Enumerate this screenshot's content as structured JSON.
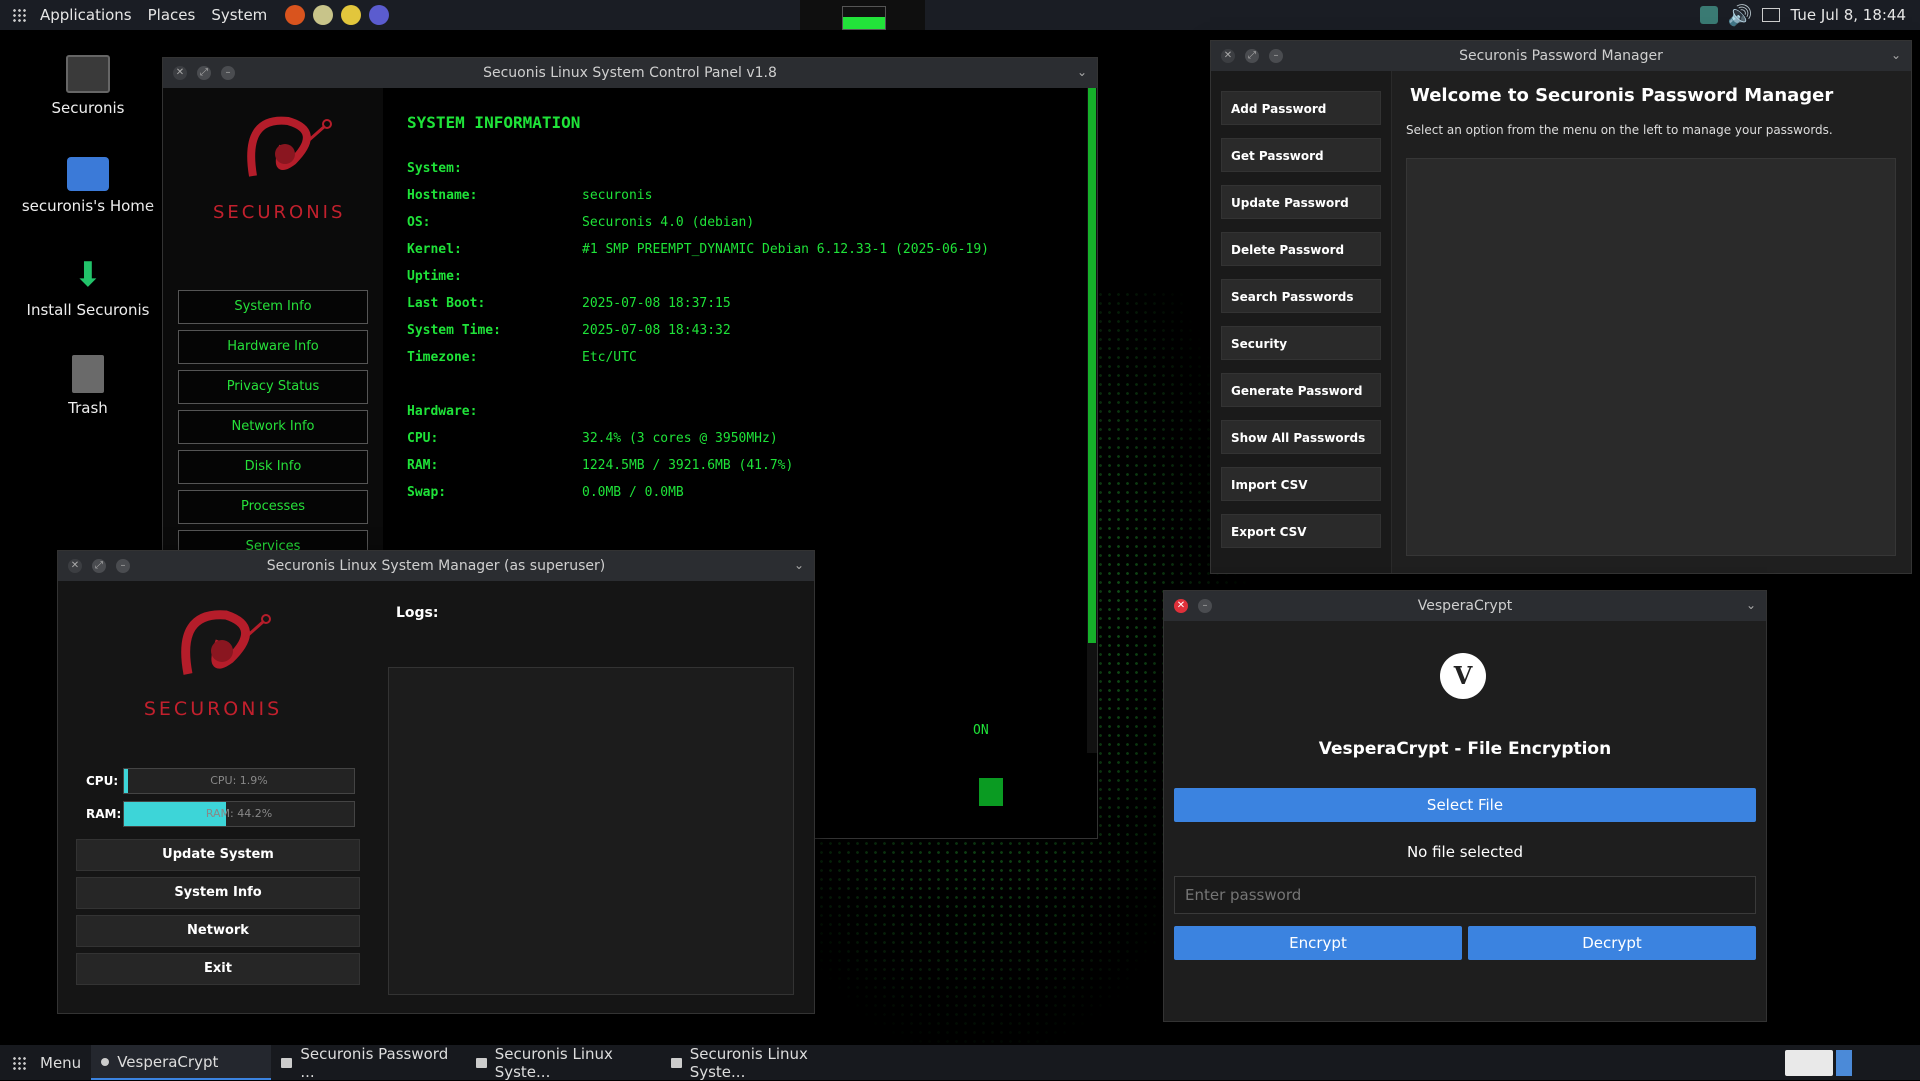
{
  "top_panel": {
    "menus": [
      "Applications",
      "Places",
      "System"
    ],
    "clock": "Tue Jul  8, 18:44"
  },
  "desktop_icons": [
    {
      "label": "Securonis"
    },
    {
      "label": "securonis's Home"
    },
    {
      "label": "Install Securonis"
    },
    {
      "label": "Trash"
    }
  ],
  "control_panel": {
    "title": "Secuonis Linux System Control Panel v1.8",
    "logo_text": "SECURONIS",
    "nav": [
      "System Info",
      "Hardware Info",
      "Privacy Status",
      "Network Info",
      "Disk Info",
      "Processes",
      "Services"
    ],
    "heading": "SYSTEM INFORMATION",
    "rows": [
      {
        "k": "System:",
        "v": ""
      },
      {
        "k": "Hostname:",
        "v": "securonis"
      },
      {
        "k": "OS:",
        "v": "Securonis 4.0 (debian)"
      },
      {
        "k": "Kernel:",
        "v": "#1 SMP PREEMPT_DYNAMIC Debian 6.12.33-1 (2025-06-19)"
      },
      {
        "k": "Uptime:",
        "v": ""
      },
      {
        "k": "Last Boot:",
        "v": "2025-07-08 18:37:15"
      },
      {
        "k": "System Time:",
        "v": "2025-07-08 18:43:32"
      },
      {
        "k": "Timezone:",
        "v": "Etc/UTC"
      },
      {
        "k": "Hardware:",
        "v": ""
      },
      {
        "k": "CPU:",
        "v": "32.4% (3 cores @ 3950MHz)"
      },
      {
        "k": "RAM:",
        "v": "1224.5MB / 3921.6MB (41.7%)"
      },
      {
        "k": "Swap:",
        "v": "0.0MB / 0.0MB"
      }
    ],
    "partial_text": "ON"
  },
  "system_manager": {
    "title": "Securonis Linux System Manager (as superuser)",
    "logo_text": "SECURONIS",
    "logs_label": "Logs:",
    "cpu_label": "CPU:",
    "cpu_text": "CPU: 1.9%",
    "cpu_value": 1.9,
    "ram_label": "RAM:",
    "ram_text": "RAM: 44.2%",
    "ram_value": 44.2,
    "buttons": [
      "Update System",
      "System Info",
      "Network",
      "Exit"
    ]
  },
  "password_manager": {
    "title": "Securonis Password Manager",
    "heading": "Welcome to Securonis Password Manager",
    "subtitle": "Select an option from the menu on the left to manage your passwords.",
    "menu": [
      "Add Password",
      "Get Password",
      "Update Password",
      "Delete Password",
      "Search Passwords",
      "Security",
      "Generate Password",
      "Show All Passwords",
      "Import CSV",
      "Export CSV"
    ]
  },
  "vesperacrypt": {
    "title": "VesperaCrypt",
    "logo_letter": "V",
    "heading": "VesperaCrypt - File Encryption",
    "select_file": "Select File",
    "status": "No file selected",
    "password_placeholder": "Enter password",
    "encrypt": "Encrypt",
    "decrypt": "Decrypt",
    "accent": "#3b83e0"
  },
  "taskbar": {
    "menu": "Menu",
    "tasks": [
      "VesperaCrypt",
      "Securonis Password ...",
      "Securonis Linux Syste...",
      "Securonis Linux Syste..."
    ]
  }
}
